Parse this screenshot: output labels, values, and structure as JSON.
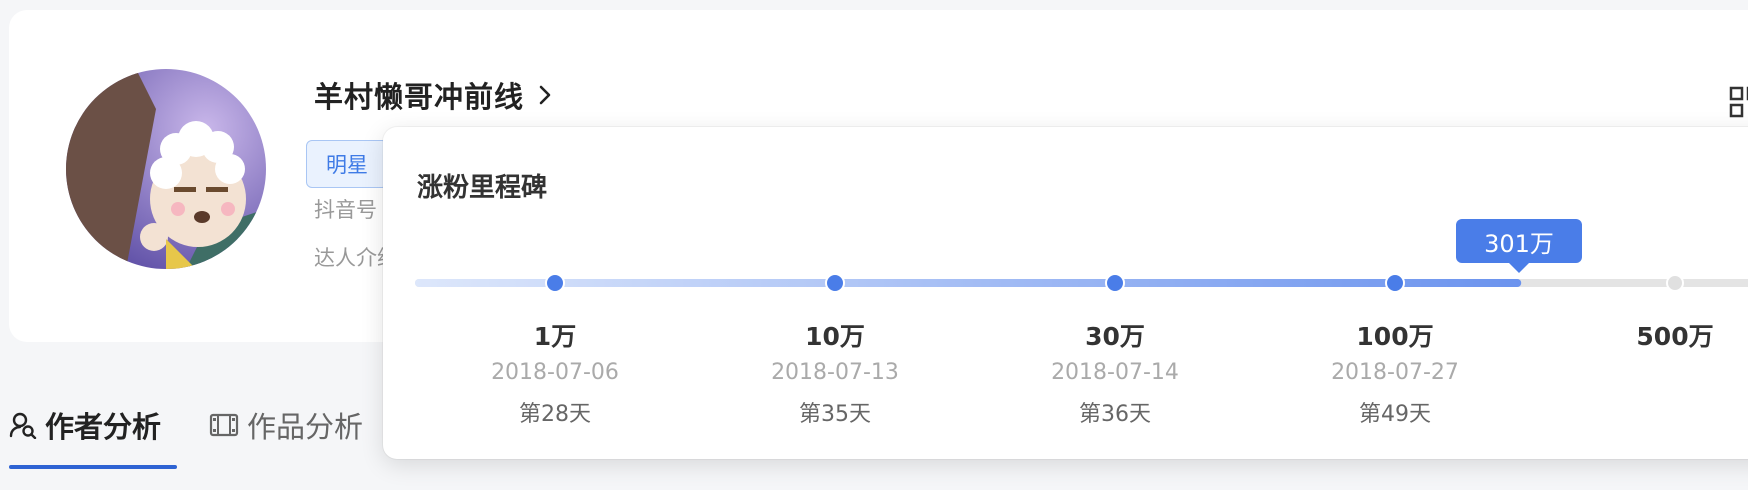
{
  "profile": {
    "name": "羊村懒哥冲前线",
    "tag": "明星",
    "douyin_label": "抖音号",
    "intro_label": "达人介绍"
  },
  "tabs": [
    {
      "label": "作者分析",
      "icon": "user-search-icon",
      "active": true
    },
    {
      "label": "作品分析",
      "icon": "film-icon",
      "active": false
    }
  ],
  "milestone_popover": {
    "title": "涨粉里程碑",
    "current_label": "301万",
    "progress_fraction": 0.797,
    "milestones": [
      {
        "value": "1万",
        "date": "2018-07-06",
        "day": "第28天",
        "reached": true
      },
      {
        "value": "10万",
        "date": "2018-07-13",
        "day": "第35天",
        "reached": true
      },
      {
        "value": "30万",
        "date": "2018-07-14",
        "day": "第36天",
        "reached": true
      },
      {
        "value": "100万",
        "date": "2018-07-27",
        "day": "第49天",
        "reached": true
      },
      {
        "value": "500万",
        "date": "",
        "day": "",
        "reached": false
      }
    ]
  },
  "colors": {
    "accent": "#4a7de8",
    "tab_underline": "#2e63d3",
    "tag_text": "#3f7be6"
  }
}
